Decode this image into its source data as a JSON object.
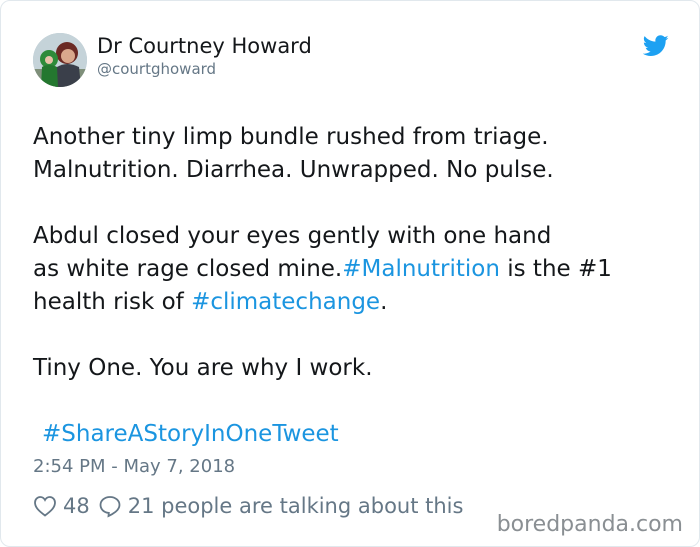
{
  "author": {
    "name": "Dr Courtney Howard",
    "handle": "@courtghoward"
  },
  "tweet": {
    "line_1": "Another tiny limp bundle rushed from triage.",
    "line_2": "Malnutrition. Diarrhea. Unwrapped. No pulse.",
    "line_3": "Abdul closed your eyes gently with one hand",
    "line_4_prefix": "as white rage closed mine.",
    "hashtag_malnutrition": "#Malnutrition",
    "line_4_suffix": " is the #1",
    "line_5_prefix": "health risk of ",
    "hashtag_climatechange": "#climatechange",
    "line_5_suffix": ".",
    "line_6": "Tiny One. You are why I work.",
    "hashtag_share": "#ShareAStoryInOneTweet"
  },
  "meta": {
    "timestamp": "2:54 PM - May 7, 2018",
    "likes": "48",
    "replies_text": "21 people are talking about this"
  },
  "watermark": "boredpanda.com",
  "colors": {
    "link": "#1b95e0",
    "secondary_text": "#657786",
    "primary_text": "#14171a",
    "twitter_blue": "#1da1f2"
  },
  "icons": {
    "brand": "twitter-bird-icon",
    "like": "heart-icon",
    "reply": "speech-bubble-icon"
  }
}
